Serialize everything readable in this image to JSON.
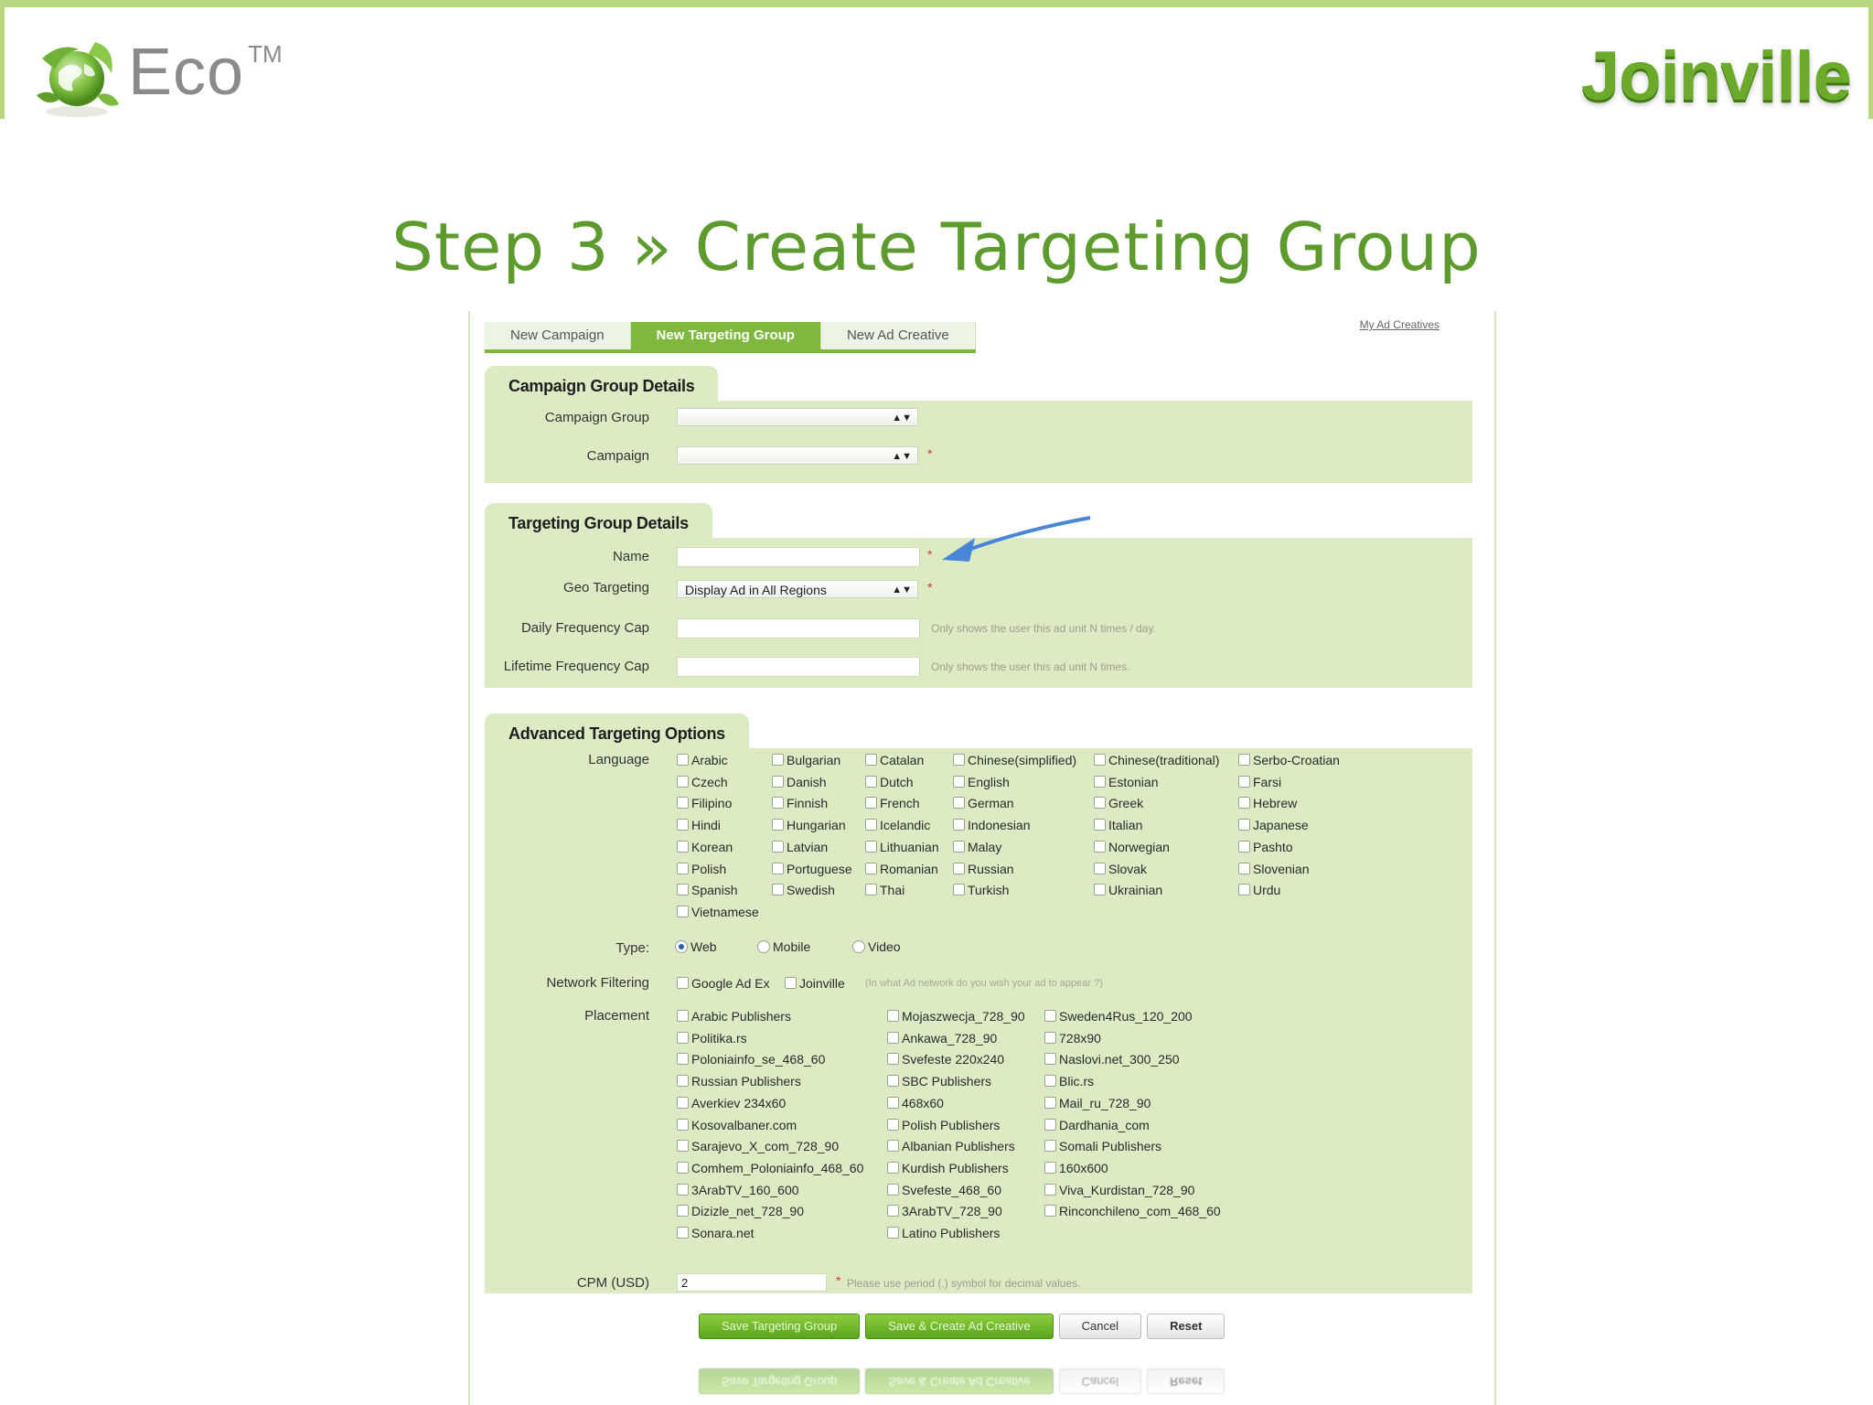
{
  "brand": {
    "eco_name": "Eco",
    "eco_mark": "TM",
    "right_logo": "Joinville",
    "colors": {
      "accent_green": "#6caa2b",
      "panel_green": "#dcebc4",
      "title_green": "#5e9b2f"
    }
  },
  "slide": {
    "title": "Step 3 » Create Targeting Group"
  },
  "app": {
    "tabs": [
      "New Campaign",
      "New Targeting Group",
      "New Ad Creative"
    ],
    "active_tab": "New Targeting Group",
    "top_link": "My Ad Creatives",
    "campaign_group_details": {
      "heading": "Campaign Group Details",
      "campaign_group_label": "Campaign Group",
      "campaign_label": "Campaign",
      "campaign_group_value": "",
      "campaign_value": ""
    },
    "targeting_group_details": {
      "heading": "Targeting Group Details",
      "name_label": "Name",
      "name_value": "",
      "geo_label": "Geo Targeting",
      "geo_value": "Display Ad in All Regions",
      "daily_cap_label": "Daily Frequency Cap",
      "daily_cap_hint": "Only shows the user this ad unit N times / day.",
      "lifetime_cap_label": "Lifetime Frequency Cap",
      "lifetime_cap_hint": "Only shows the user this ad unit N times."
    },
    "advanced": {
      "heading": "Advanced Targeting Options",
      "language_label": "Language",
      "languages": [
        [
          "Arabic",
          "Bulgarian",
          "Catalan",
          "Chinese(simplified)",
          "Chinese(traditional)",
          "Serbo-Croatian"
        ],
        [
          "Czech",
          "Danish",
          "Dutch",
          "English",
          "Estonian",
          "Farsi"
        ],
        [
          "Filipino",
          "Finnish",
          "French",
          "German",
          "Greek",
          "Hebrew"
        ],
        [
          "Hindi",
          "Hungarian",
          "Icelandic",
          "Indonesian",
          "Italian",
          "Japanese"
        ],
        [
          "Korean",
          "Latvian",
          "Lithuanian",
          "Malay",
          "Norwegian",
          "Pashto"
        ],
        [
          "Polish",
          "Portuguese",
          "Romanian",
          "Russian",
          "Slovak",
          "Slovenian"
        ],
        [
          "Spanish",
          "Swedish",
          "Thai",
          "Turkish",
          "Ukrainian",
          "Urdu"
        ],
        [
          "Vietnamese"
        ]
      ],
      "type_label": "Type:",
      "types": [
        "Web",
        "Mobile",
        "Video"
      ],
      "selected_type": "Web",
      "network_label": "Network Filtering",
      "networks": [
        "Google Ad Ex",
        "Joinville"
      ],
      "network_hint": "(In what Ad network do you wish your ad to appear ?)",
      "placement_label": "Placement",
      "placements_col1": [
        "Arabic Publishers",
        "Politika.rs",
        "Poloniainfo_se_468_60",
        "Russian Publishers",
        "Averkiev 234x60",
        "Kosovalbaner.com",
        "Sarajevo_X_com_728_90",
        "Comhem_Poloniainfo_468_60",
        "3ArabTV_160_600",
        "Dizizle_net_728_90",
        "Sonara.net"
      ],
      "placements_col2": [
        "Mojaszwecja_728_90",
        "Ankawa_728_90",
        "Svefeste 220x240",
        "SBC Publishers",
        "468x60",
        "Polish Publishers",
        "Albanian Publishers",
        "Kurdish Publishers",
        "Svefeste_468_60",
        "3ArabTV_728_90",
        "Latino Publishers"
      ],
      "placements_col3": [
        "Sweden4Rus_120_200",
        "728x90",
        "Naslovi.net_300_250",
        "Blic.rs",
        "Mail_ru_728_90",
        "Dardhania_com",
        "Somali Publishers",
        "160x600",
        "Viva_Kurdistan_728_90",
        "Rinconchileno_com_468_60"
      ],
      "cpm_label": "CPM  (USD)",
      "cpm_value": "2",
      "cpm_hint": "Please use period (.) symbol for decimal values."
    },
    "buttons": {
      "save": "Save Targeting Group",
      "save_create": "Save & Create Ad Creative",
      "cancel": "Cancel",
      "reset": "Reset"
    },
    "required_mark": "*"
  }
}
